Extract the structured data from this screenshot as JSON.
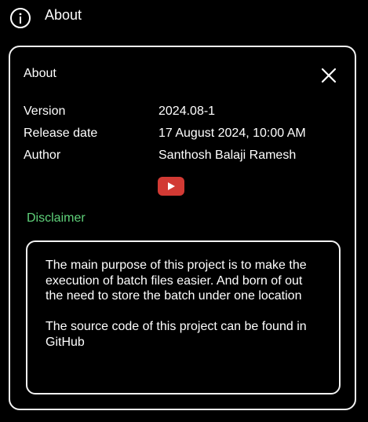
{
  "topbar": {
    "title": "About",
    "icon": "info-icon"
  },
  "dialog": {
    "title": "About",
    "close_icon": "close-icon",
    "rows": [
      {
        "label": "Version",
        "value": "2024.08-1"
      },
      {
        "label": "Release date",
        "value": "17 August 2024, 10:00 AM"
      },
      {
        "label": "Author",
        "value": "Santhosh Balaji Ramesh"
      }
    ],
    "youtube_icon": "youtube-icon",
    "disclaimer": {
      "label": "Disclaimer",
      "text": "The main purpose of this project is to make the execution of batch files easier. And born of out the need to store the batch under one location\n\nThe source code of this project can be found in GitHub"
    }
  },
  "colors": {
    "background": "#000000",
    "foreground": "#ffffff",
    "disclaimer_label": "#5fd27a",
    "youtube_red": "#d23a34"
  }
}
